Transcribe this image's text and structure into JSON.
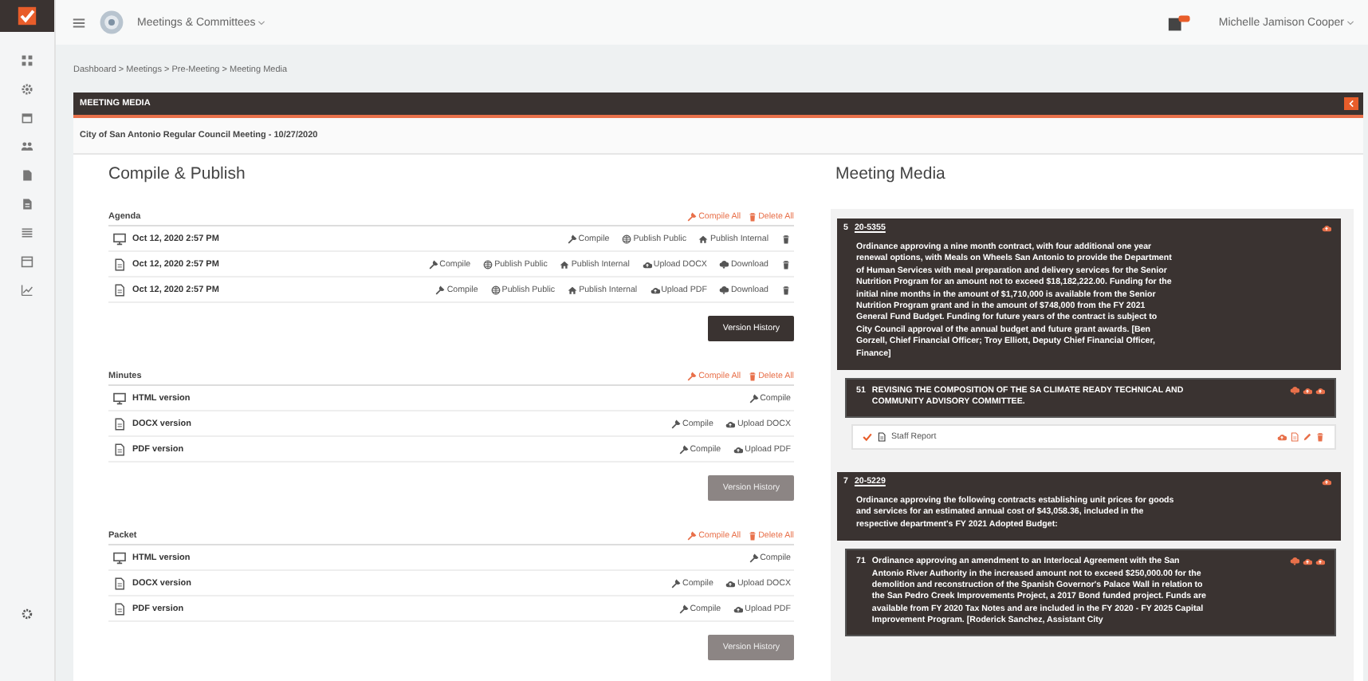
{
  "topbar": {
    "module": "Meetings & Committees",
    "user": "Michelle Jamison Cooper"
  },
  "breadcrumb": "Dashboard > Meetings > Pre-Meeting > Meeting Media",
  "panel": {
    "title": "MEETING MEDIA",
    "meeting": "City of San Antonio Regular Council Meeting - 10/27/2020"
  },
  "compile": {
    "title": "Compile & Publish",
    "sections": [
      {
        "title": "Agenda",
        "actions": [
          {
            "kind": "compile",
            "label": "Compile All"
          },
          {
            "kind": "delete",
            "label": "Delete All"
          }
        ],
        "rows": [
          {
            "kind": "monitor",
            "label": "Oct 12, 2020 2:57 PM",
            "actions": [
              {
                "kind": "compile",
                "label": "Compile"
              },
              {
                "kind": "publish_public",
                "label": "Publish Public"
              },
              {
                "kind": "publish_internal",
                "label": "Publish Internal"
              },
              {
                "kind": "delete"
              }
            ]
          },
          {
            "kind": "document",
            "label": "Oct 12, 2020 2:57 PM",
            "actions": [
              {
                "kind": "compile",
                "label": "Compile"
              },
              {
                "kind": "publish_public",
                "label": "Publish Public"
              },
              {
                "kind": "publish_internal",
                "label": "Publish Internal"
              },
              {
                "kind": "upload",
                "label": "Upload DOCX"
              },
              {
                "kind": "download",
                "label": "Download"
              },
              {
                "kind": "delete"
              }
            ]
          },
          {
            "kind": "document",
            "label": "Oct 12, 2020 2:57 PM",
            "actions": [
              {
                "kind": "compile",
                "label": "Compile"
              },
              {
                "kind": "publish_public",
                "label": "Publish Public"
              },
              {
                "kind": "publish_internal",
                "label": "Publish Internal"
              },
              {
                "kind": "upload",
                "label": "Upload PDF"
              },
              {
                "kind": "download",
                "label": "Download"
              },
              {
                "kind": "delete"
              }
            ]
          }
        ],
        "version_history": {
          "label": "Version History",
          "disabled": false
        }
      },
      {
        "title": "Minutes",
        "actions": [
          {
            "kind": "compile",
            "label": "Compile All"
          },
          {
            "kind": "delete",
            "label": "Delete All"
          }
        ],
        "rows": [
          {
            "kind": "monitor",
            "label": "HTML version",
            "actions": [
              {
                "kind": "compile",
                "label": "Compile"
              }
            ]
          },
          {
            "kind": "document",
            "label": "DOCX version",
            "actions": [
              {
                "kind": "compile",
                "label": "Compile"
              },
              {
                "kind": "upload",
                "label": "Upload DOCX"
              }
            ]
          },
          {
            "kind": "document",
            "label": "PDF version",
            "actions": [
              {
                "kind": "compile",
                "label": "Compile"
              },
              {
                "kind": "upload",
                "label": "Upload PDF"
              }
            ]
          }
        ],
        "version_history": {
          "label": "Version History",
          "disabled": true
        }
      },
      {
        "title": "Packet",
        "actions": [
          {
            "kind": "compile",
            "label": "Compile All"
          },
          {
            "kind": "delete",
            "label": "Delete All"
          }
        ],
        "rows": [
          {
            "kind": "monitor",
            "label": "HTML version",
            "actions": [
              {
                "kind": "compile",
                "label": "Compile"
              }
            ]
          },
          {
            "kind": "document",
            "label": "DOCX version",
            "actions": [
              {
                "kind": "compile",
                "label": "Compile"
              },
              {
                "kind": "upload",
                "label": "Upload DOCX"
              }
            ]
          },
          {
            "kind": "document",
            "label": "PDF version",
            "actions": [
              {
                "kind": "compile",
                "label": "Compile"
              },
              {
                "kind": "upload",
                "label": "Upload PDF"
              }
            ]
          }
        ],
        "version_history": {
          "label": "Version History",
          "disabled": true
        }
      }
    ]
  },
  "media": {
    "title": "Meeting Media",
    "items": [
      {
        "number": "5",
        "link": "20-5355",
        "description": "Ordinance approving a nine month contract, with four additional one year renewal options, with Meals on Wheels San Antonio to provide the Department of Human Services with meal preparation and delivery services for the Senior Nutrition Program for an amount not to exceed $18,182,222.00. Funding for the initial nine months in the amount of $1,710,000 is available from the Senior Nutrition Program grant and in the amount of $748,000 from the FY 2021 General Fund Budget. Funding for future years of the contract is subject to City Council approval of the annual budget and future grant awards. [Ben Gorzell, Chief Financial Officer; Troy Elliott, Deputy Chief Financial Officer, Finance]",
        "children": [
          {
            "number": "51",
            "text": "REVISING THE COMPOSITION OF THE SA CLIMATE READY TECHNICAL AND COMMUNITY ADVISORY COMMITTEE.",
            "attachments": [
              {
                "label": "Staff Report",
                "checked": true
              }
            ]
          }
        ]
      },
      {
        "number": "7",
        "link": "20-5229",
        "description": "Ordinance approving the following contracts establishing unit prices for goods and services for an estimated annual cost of $43,058.36, included in the respective department's FY 2021 Adopted Budget:",
        "children": [
          {
            "number": "71",
            "text": "Ordinance approving an amendment to an Interlocal Agreement with the San Antonio River Authority in the increased amount not to exceed $250,000.00 for the demolition and reconstruction of the Spanish Governor's Palace Wall in relation to the San Pedro Creek Improvements Project, a 2017 Bond funded project. Funds are available from FY 2020 Tax Notes and are included in the FY 2020 - FY 2025 Capital Improvement Program. [Roderick Sanchez, Assistant City"
          }
        ]
      }
    ]
  }
}
